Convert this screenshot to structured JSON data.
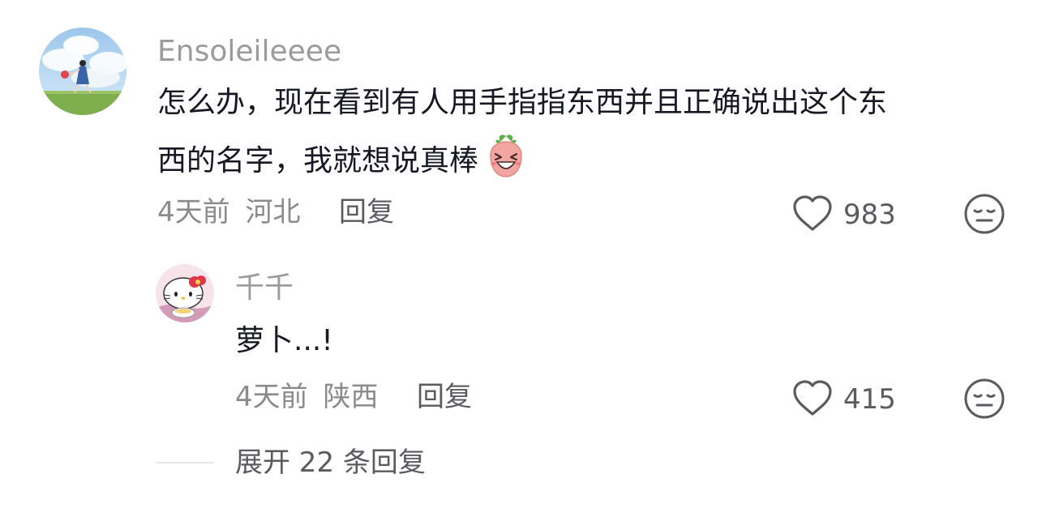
{
  "comment": {
    "username": "Ensoleileeee",
    "text_line1": "怎么办，现在看到有人用手指指东西并且正确说出这个东",
    "text_line2": "西的名字，我就想说真棒",
    "emoji": "laughing-radish-sticker",
    "time": "4天前",
    "location": "河北",
    "reply_label": "回复",
    "likes": "983",
    "like_icon": "heart-outline-icon",
    "dislike_icon": "meh-face-icon"
  },
  "reply": {
    "username": "千千",
    "text": "萝卜...!",
    "time": "4天前",
    "location": "陕西",
    "reply_label": "回复",
    "likes": "415",
    "like_icon": "heart-outline-icon",
    "dislike_icon": "meh-face-icon"
  },
  "expand": {
    "label": "展开 22 条回复"
  },
  "colors": {
    "text_primary": "#161823",
    "text_secondary": "#8a8a8f",
    "username": "#9a9a9f",
    "divider": "#e6e6e8"
  }
}
